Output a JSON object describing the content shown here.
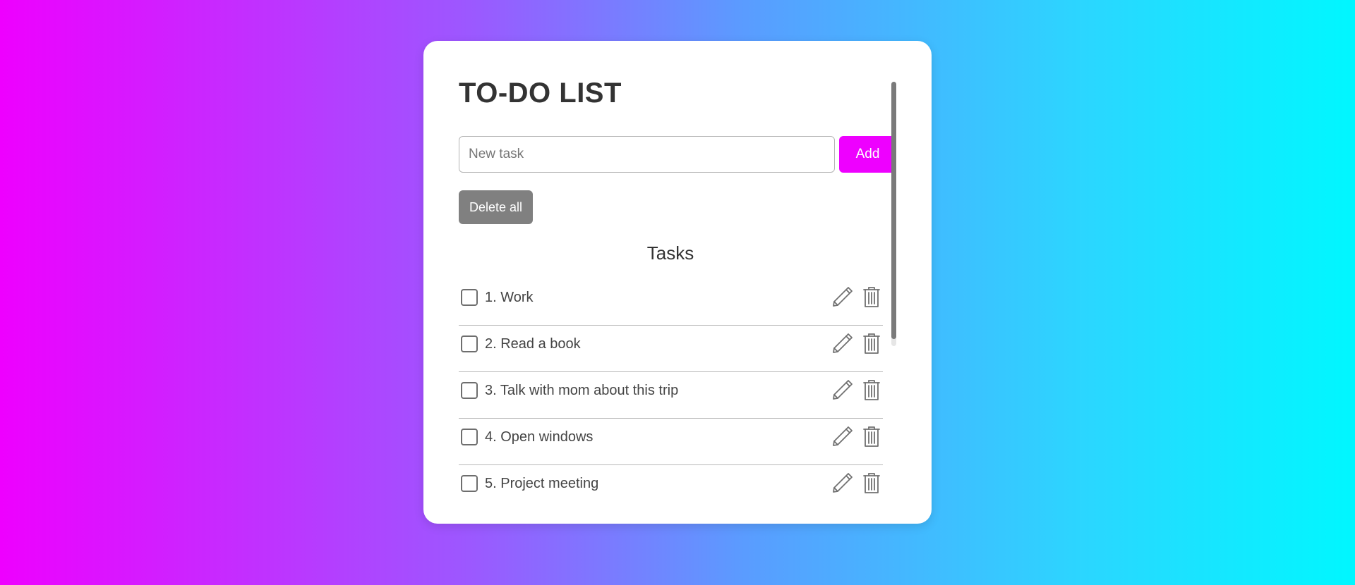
{
  "app": {
    "title": "TO-DO LIST"
  },
  "input": {
    "value": "",
    "placeholder": "New task"
  },
  "buttons": {
    "add_label": "Add",
    "delete_all_label": "Delete all"
  },
  "tasks_section": {
    "heading": "Tasks",
    "items": [
      {
        "label": "1. Work",
        "checked": false
      },
      {
        "label": "2. Read a book",
        "checked": false
      },
      {
        "label": "3. Talk with mom about this trip",
        "checked": false
      },
      {
        "label": "4. Open windows",
        "checked": false
      },
      {
        "label": "5. Project meeting",
        "checked": false
      }
    ]
  },
  "icons": {
    "edit": "pencil-icon",
    "delete": "trash-icon"
  },
  "colors": {
    "accent": "#ee00ff",
    "delete_all": "#808080",
    "text": "#333333"
  }
}
